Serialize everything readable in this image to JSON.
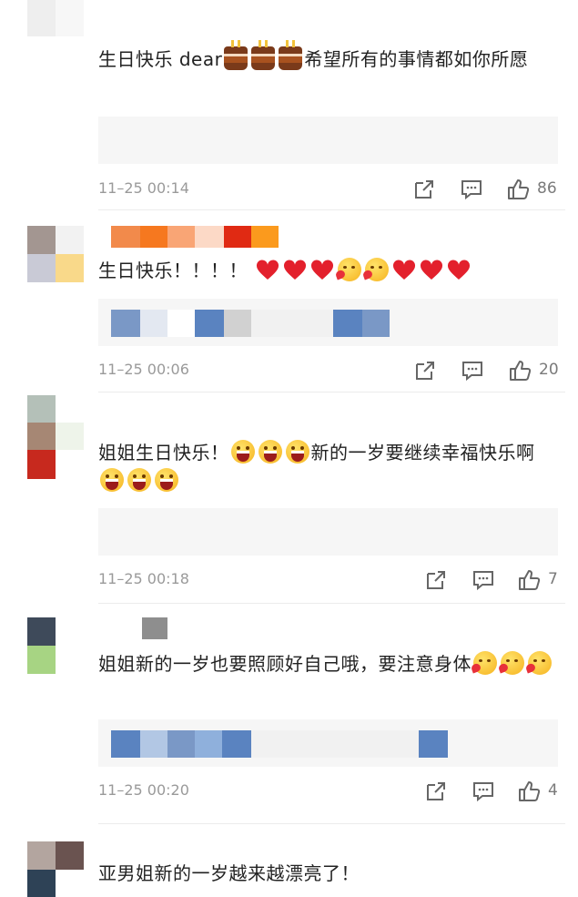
{
  "comments": [
    {
      "text_before": "生日快乐 dear",
      "emojis_mid": [
        "cake-emoji",
        "cake-emoji",
        "cake-emoji"
      ],
      "text_after": "希望所有的事情都如你所愿",
      "time": "11–25 00:14",
      "likes": "86"
    },
    {
      "text_before": "生日快乐！！！！",
      "emojis_mid": [
        "heart-emoji",
        "heart-emoji",
        "heart-emoji",
        "kiss-emoji",
        "kiss-emoji",
        "heart-emoji",
        "heart-emoji",
        "heart-emoji"
      ],
      "text_after": "",
      "time": "11–25 00:06",
      "likes": "20"
    },
    {
      "text_before": "姐姐生日快乐！",
      "emojis_mid": [
        "grin-emoji",
        "grin-emoji",
        "grin-emoji"
      ],
      "text_after": "新的一岁要继续幸福快乐啊",
      "emojis_end": [
        "grin-emoji",
        "grin-emoji",
        "grin-emoji"
      ],
      "time": "11–25 00:18",
      "likes": "7"
    },
    {
      "text_before": "姐姐新的一岁也要照顾好自己哦，要注意身体",
      "emojis_mid": [
        "kiss-emoji",
        "kiss-emoji",
        "kiss-emoji"
      ],
      "text_after": "",
      "time": "11–25 00:20",
      "likes": "4"
    },
    {
      "text_before": "亚男姐新的一岁越来越漂亮了！",
      "emojis_mid": [],
      "text_after": ""
    }
  ],
  "icons": {
    "share": "share-icon",
    "reply": "comment-icon",
    "like": "thumbs-up-icon"
  }
}
